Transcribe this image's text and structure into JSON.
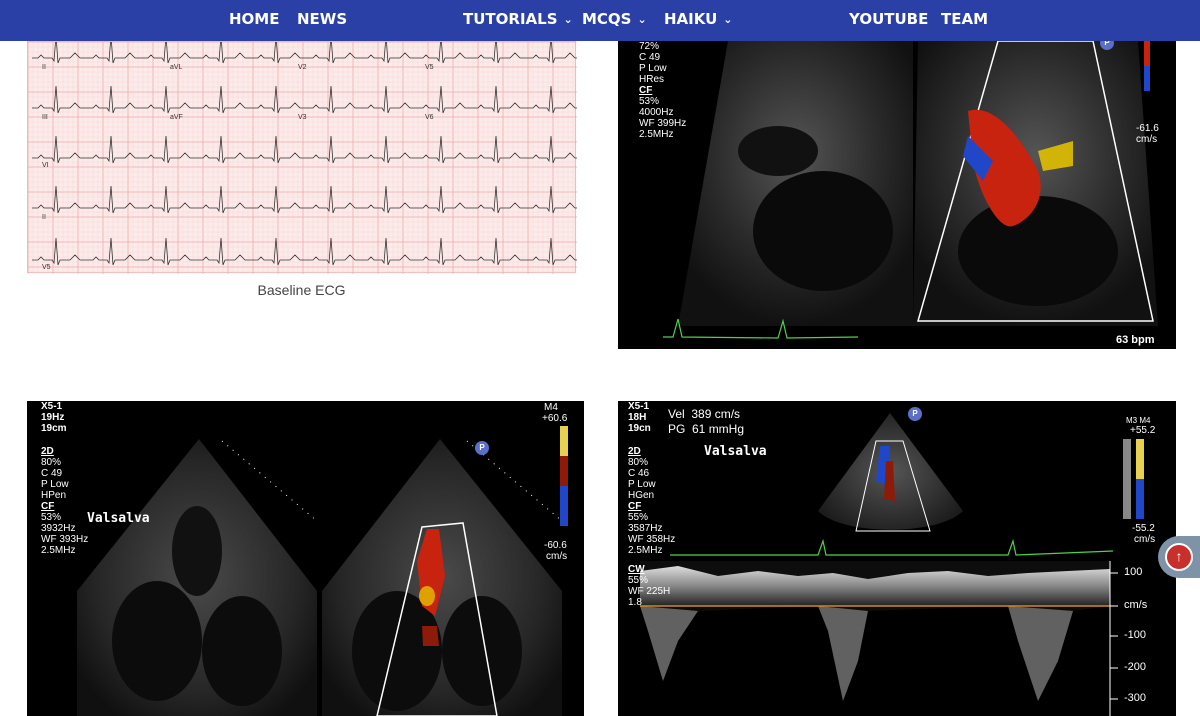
{
  "nav": {
    "home": "HOME",
    "news": "NEWS",
    "tutorials": "TUTORIALS",
    "mcqs": "MCQS",
    "haiku": "HAIKU",
    "youtube": "YOUTUBE",
    "team": "TEAM",
    "chevron": "⌄"
  },
  "ecg": {
    "caption": "Baseline ECG",
    "leads": [
      "II",
      "aVL",
      "V2",
      "V5",
      "III",
      "aVF",
      "V3",
      "V6",
      "VI",
      "II",
      "V5"
    ]
  },
  "echo_top_right": {
    "settings": [
      "72%",
      "C 49",
      "P Low",
      "HRes"
    ],
    "cf_label": "CF",
    "cf_settings": [
      "53%",
      "4000Hz",
      "WF 399Hz",
      "2.5MHz"
    ],
    "scale_low": "-61.6",
    "scale_unit": "cm/s",
    "hr": "63 bpm",
    "badge": "P"
  },
  "echo_bottom_left": {
    "probe": "X5-1",
    "fps": "19Hz",
    "depth": "19cm",
    "mode": "2D",
    "settings": [
      "80%",
      "C 49",
      "P Low",
      "HPen"
    ],
    "cf_label": "CF",
    "cf_settings": [
      "53%",
      "3932Hz",
      "WF 393Hz",
      "2.5MHz"
    ],
    "maneuver": "Valsalva",
    "scale_preset": "M4",
    "scale_high": "+60.6",
    "scale_low": "-60.6",
    "scale_unit": "cm/s",
    "badge": "P"
  },
  "echo_bottom_right": {
    "probe": "X5-1",
    "fps": "18H",
    "depth": "19cn",
    "vel": "Vel  389 cm/s",
    "pg": "PG  61 mmHg",
    "maneuver": "Valsalva",
    "mode": "2D",
    "settings": [
      "80%",
      "C 46",
      "P Low",
      "HGen"
    ],
    "cf_label": "CF",
    "cf_settings": [
      "55%",
      "3587Hz",
      "WF 358Hz",
      "2.5MHz"
    ],
    "cw_label": "CW",
    "cw_settings": [
      "55%",
      "WF 225H",
      "1.8"
    ],
    "scale_preset": "M3 M4",
    "scale_high": "+55.2",
    "scale_low": "-55.2",
    "scale_unit": "cm/s",
    "axis_ticks": [
      "100",
      "cm/s",
      "-100",
      "-200",
      "-300"
    ],
    "badge": "P"
  },
  "colors": {
    "nav_bg": "#2a40a6",
    "doppler_red": "#c8230f",
    "doppler_blue": "#1f47c8",
    "ecg_green": "#4fd14a"
  }
}
